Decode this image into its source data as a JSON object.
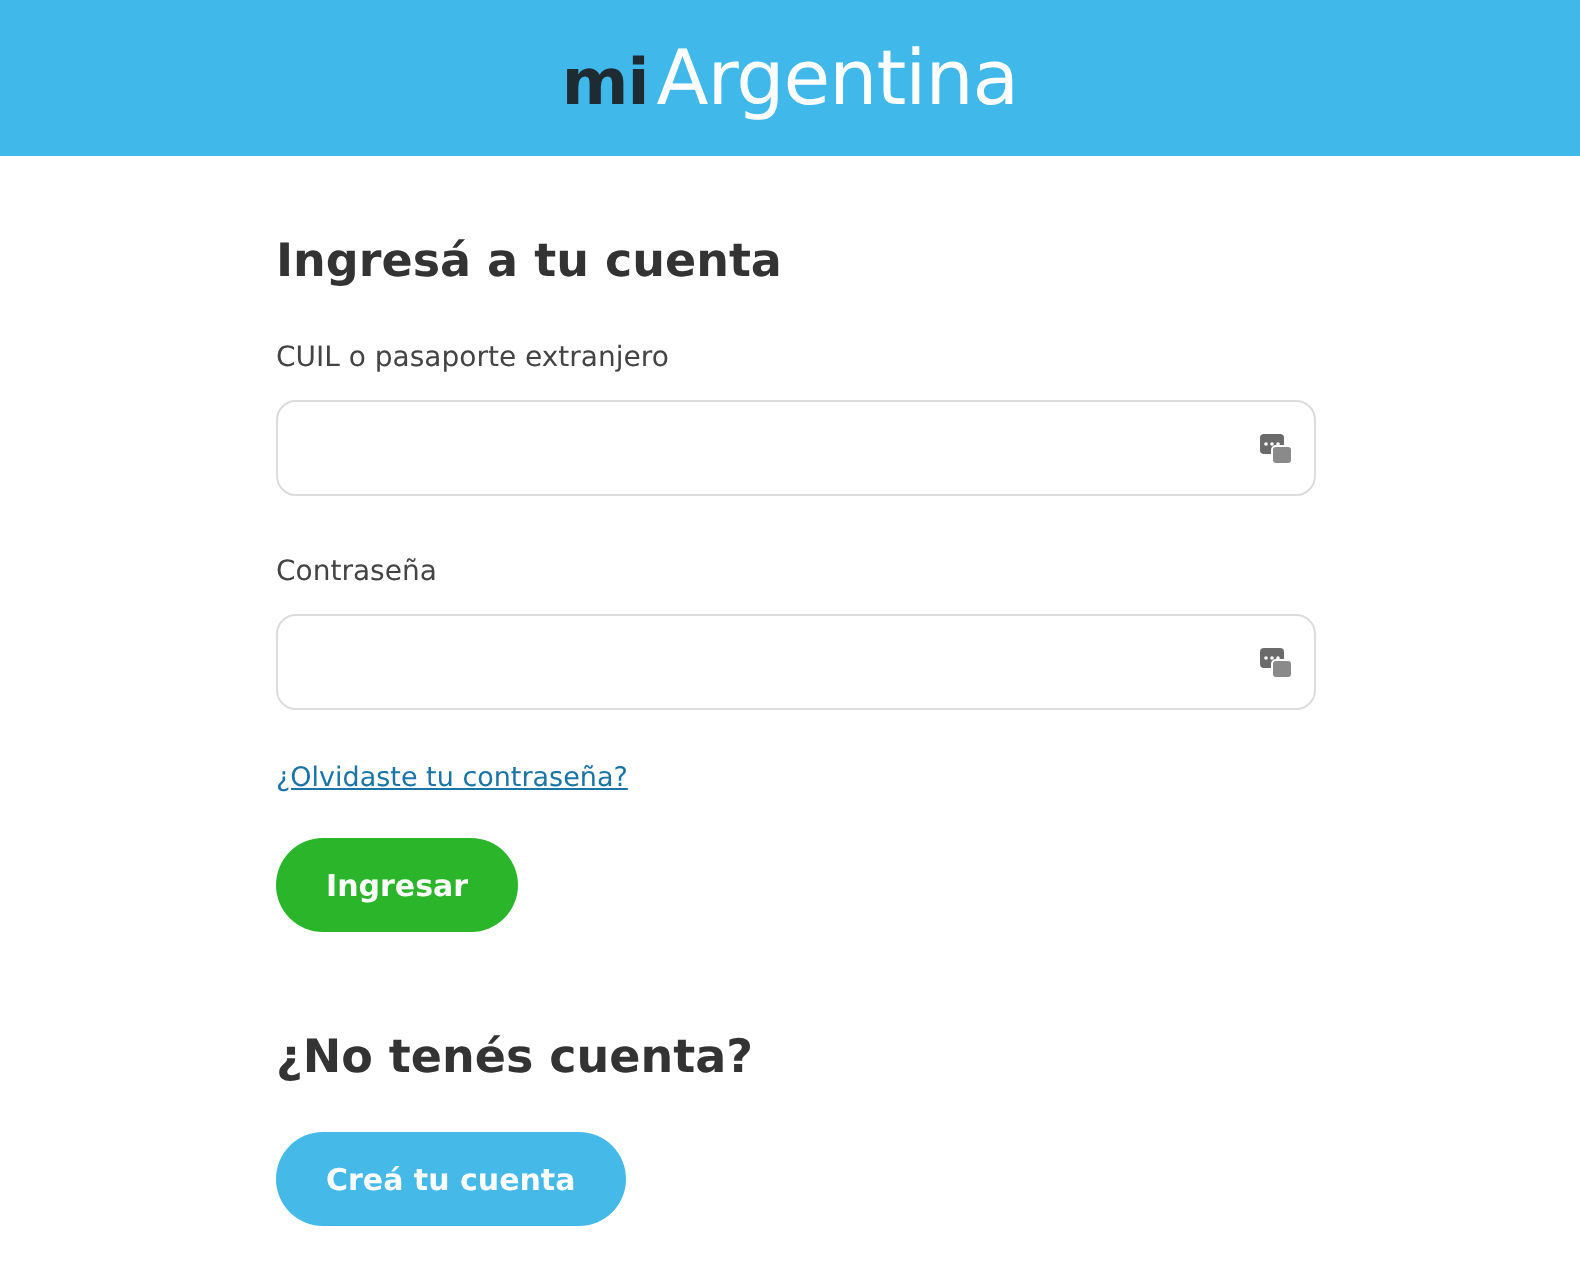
{
  "header": {
    "logo_prefix": "mi",
    "logo_name": "Argentina"
  },
  "login": {
    "title": "Ingresá a tu cuenta",
    "fields": [
      {
        "label": "CUIL o pasaporte extranjero"
      },
      {
        "label": "Contraseña"
      }
    ],
    "forgot_link": "¿Olvidaste tu contraseña?",
    "submit_button": "Ingresar"
  },
  "signup": {
    "title": "¿No tenés cuenta?",
    "button": "Creá tu cuenta"
  }
}
